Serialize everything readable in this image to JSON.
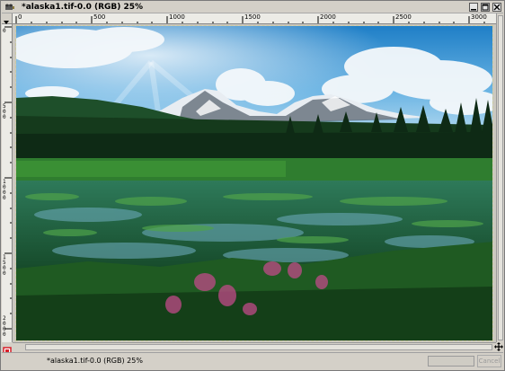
{
  "window": {
    "title": "*alaska1.tif-0.0 (RGB) 25%",
    "title_icon": "gimp-wilber-icon",
    "controls": [
      "minimize-icon",
      "maximize-icon",
      "close-icon"
    ]
  },
  "rulers": {
    "horizontal_labels": [
      "0",
      "500",
      "1000",
      "1500",
      "2000",
      "2500",
      "3000"
    ],
    "vertical_labels": [
      "0",
      "500",
      "1000",
      "1500",
      "2000"
    ]
  },
  "canvas": {
    "image_name": "alaska1.tif",
    "mode": "RGB",
    "zoom": "25%"
  },
  "statusbar": {
    "text": "*alaska1.tif-0.0 (RGB) 25%",
    "cancel_label": "Cancel"
  },
  "colors": {
    "window_bg": "#d4d0c8",
    "ruler_bg": "#ecebe6",
    "qmask_red": "#d8202a"
  }
}
